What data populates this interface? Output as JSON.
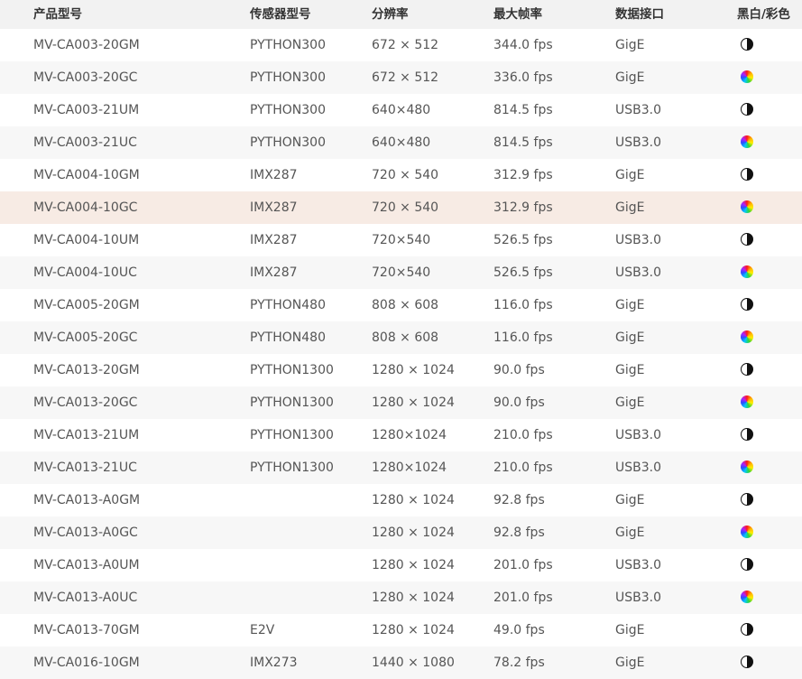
{
  "table": {
    "headers": {
      "model": "产品型号",
      "sensor": "传感器型号",
      "resolution": "分辨率",
      "fps": "最大帧率",
      "interface": "数据接口",
      "color": "黑白/彩色"
    },
    "rows": [
      {
        "model": "MV-CA003-20GM",
        "sensor": "PYTHON300",
        "resolution": "672 × 512",
        "fps": "344.0 fps",
        "interface": "GigE",
        "color_icon": "mono-icon"
      },
      {
        "model": "MV-CA003-20GC",
        "sensor": "PYTHON300",
        "resolution": "672 × 512",
        "fps": "336.0 fps",
        "interface": "GigE",
        "color_icon": "color-icon"
      },
      {
        "model": "MV-CA003-21UM",
        "sensor": "PYTHON300",
        "resolution": "640×480",
        "fps": "814.5 fps",
        "interface": "USB3.0",
        "color_icon": "mono-icon"
      },
      {
        "model": "MV-CA003-21UC",
        "sensor": "PYTHON300",
        "resolution": "640×480",
        "fps": "814.5 fps",
        "interface": "USB3.0",
        "color_icon": "color-icon"
      },
      {
        "model": "MV-CA004-10GM",
        "sensor": "IMX287",
        "resolution": "720 × 540",
        "fps": "312.9 fps",
        "interface": "GigE",
        "color_icon": "mono-icon"
      },
      {
        "model": "MV-CA004-10GC",
        "sensor": "IMX287",
        "resolution": "720 × 540",
        "fps": "312.9 fps",
        "interface": "GigE",
        "color_icon": "color-icon"
      },
      {
        "model": "MV-CA004-10UM",
        "sensor": "IMX287",
        "resolution": "720×540",
        "fps": "526.5 fps",
        "interface": "USB3.0",
        "color_icon": "mono-icon"
      },
      {
        "model": "MV-CA004-10UC",
        "sensor": "IMX287",
        "resolution": "720×540",
        "fps": "526.5 fps",
        "interface": "USB3.0",
        "color_icon": "color-icon"
      },
      {
        "model": "MV-CA005-20GM",
        "sensor": "PYTHON480",
        "resolution": "808 × 608",
        "fps": "116.0 fps",
        "interface": "GigE",
        "color_icon": "mono-icon"
      },
      {
        "model": "MV-CA005-20GC",
        "sensor": "PYTHON480",
        "resolution": "808 × 608",
        "fps": "116.0 fps",
        "interface": "GigE",
        "color_icon": "color-icon"
      },
      {
        "model": "MV-CA013-20GM",
        "sensor": "PYTHON1300",
        "resolution": "1280 × 1024",
        "fps": "90.0 fps",
        "interface": "GigE",
        "color_icon": "mono-icon"
      },
      {
        "model": "MV-CA013-20GC",
        "sensor": "PYTHON1300",
        "resolution": "1280 × 1024",
        "fps": "90.0 fps",
        "interface": "GigE",
        "color_icon": "color-icon"
      },
      {
        "model": "MV-CA013-21UM",
        "sensor": "PYTHON1300",
        "resolution": "1280×1024",
        "fps": "210.0 fps",
        "interface": "USB3.0",
        "color_icon": "mono-icon"
      },
      {
        "model": "MV-CA013-21UC",
        "sensor": "PYTHON1300",
        "resolution": "1280×1024",
        "fps": "210.0 fps",
        "interface": "USB3.0",
        "color_icon": "color-icon"
      },
      {
        "model": "MV-CA013-A0GM",
        "sensor": "",
        "resolution": "1280 × 1024",
        "fps": "92.8 fps",
        "interface": "GigE",
        "color_icon": "mono-icon"
      },
      {
        "model": "MV-CA013-A0GC",
        "sensor": "",
        "resolution": "1280 × 1024",
        "fps": "92.8 fps",
        "interface": "GigE",
        "color_icon": "color-icon"
      },
      {
        "model": "MV-CA013-A0UM",
        "sensor": "",
        "resolution": "1280 × 1024",
        "fps": "201.0 fps",
        "interface": "USB3.0",
        "color_icon": "mono-icon"
      },
      {
        "model": "MV-CA013-A0UC",
        "sensor": "",
        "resolution": "1280 × 1024",
        "fps": "201.0 fps",
        "interface": "USB3.0",
        "color_icon": "color-icon"
      },
      {
        "model": "MV-CA013-70GM",
        "sensor": "E2V",
        "resolution": "1280 × 1024",
        "fps": "49.0 fps",
        "interface": "GigE",
        "color_icon": "mono-icon"
      },
      {
        "model": "MV-CA016-10GM",
        "sensor": "IMX273",
        "resolution": "1440 × 1080",
        "fps": "78.2 fps",
        "interface": "GigE",
        "color_icon": "mono-icon"
      }
    ],
    "hovered_row": 5
  },
  "colors": {
    "header_bg": "#f2f2f2",
    "alt_row_bg": "#f7f7f7",
    "hover_row_bg": "#f7ebe4",
    "text": "#555555",
    "header_text": "#333333"
  }
}
